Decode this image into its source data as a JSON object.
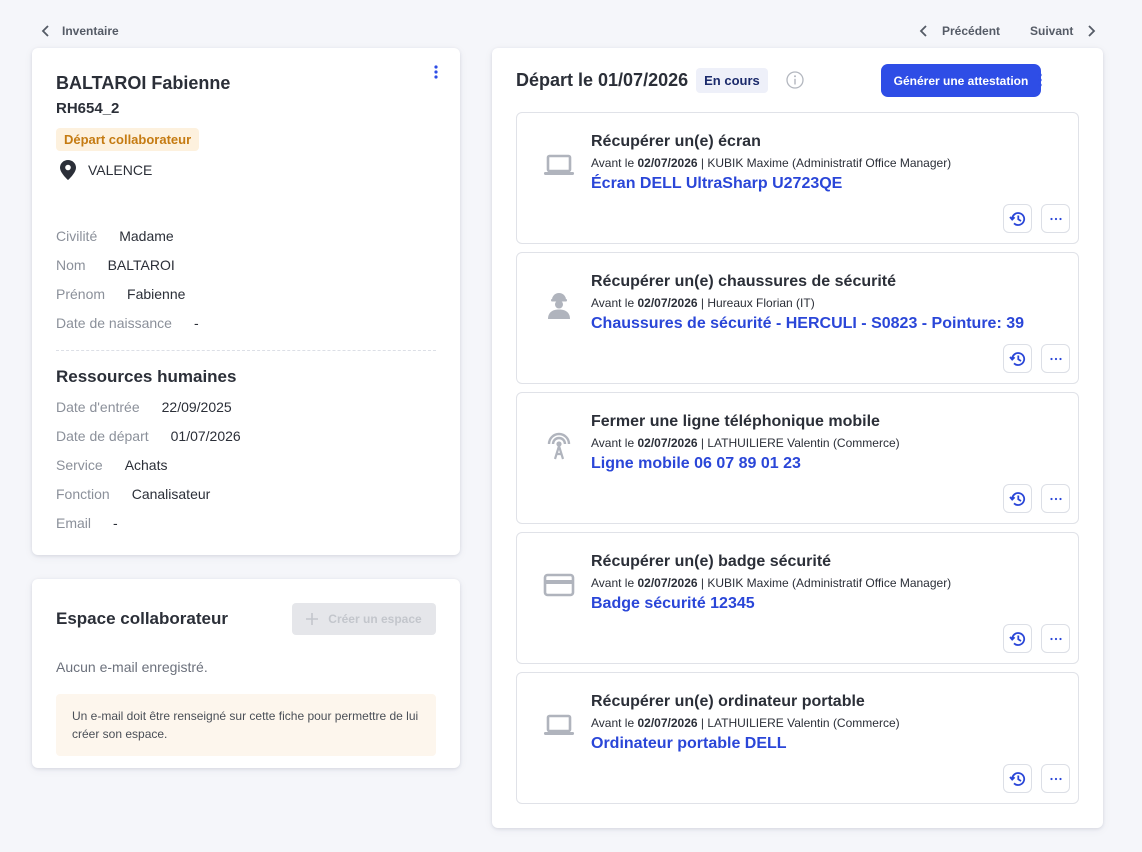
{
  "nav": {
    "back_label": "Inventaire",
    "prev_label": "Précédent",
    "next_label": "Suivant"
  },
  "profile": {
    "name": "BALTAROI Fabienne",
    "id": "RH654_2",
    "tag": "Départ collaborateur",
    "location": "VALENCE",
    "fields": [
      {
        "label": "Civilité",
        "value": "Madame"
      },
      {
        "label": "Nom",
        "value": "BALTAROI"
      },
      {
        "label": "Prénom",
        "value": "Fabienne"
      },
      {
        "label": "Date de naissance",
        "value": "-"
      }
    ],
    "hr_title": "Ressources humaines",
    "hr_fields": [
      {
        "label": "Date d'entrée",
        "value": "22/09/2025"
      },
      {
        "label": "Date de départ",
        "value": "01/07/2026"
      },
      {
        "label": "Service",
        "value": "Achats"
      },
      {
        "label": "Fonction",
        "value": "Canalisateur"
      },
      {
        "label": "Email",
        "value": "-"
      }
    ]
  },
  "espace": {
    "title": "Espace collaborateur",
    "create_label": "Créer un espace",
    "no_email": "Aucun e-mail enregistré.",
    "warning": "Un e-mail doit être renseigné sur cette fiche pour permettre de lui créer son espace."
  },
  "departure": {
    "title": "Départ le 01/07/2026",
    "status": "En cours",
    "generate_label": "Générer une attestation",
    "colors": {
      "accent": "#2e4de6",
      "link": "#2a46d8",
      "status_bg": "#eef0f9"
    },
    "tasks": [
      {
        "icon": "laptop-icon",
        "title": "Récupérer un(e) écran",
        "prefix": "Avant le ",
        "date": "02/07/2026",
        "assignee": " | KUBIK Maxime (Administratif Office Manager)",
        "item": "Écran DELL UltraSharp U2723QE"
      },
      {
        "icon": "worker-icon",
        "title": "Récupérer un(e) chaussures de sécurité",
        "prefix": "Avant le ",
        "date": "02/07/2026",
        "assignee": " | Hureaux Florian (IT)",
        "item": "Chaussures de sécurité - HERCULI - S0823 - Pointure: 39"
      },
      {
        "icon": "antenna-icon",
        "title": "Fermer une ligne téléphonique mobile",
        "prefix": "Avant le ",
        "date": "02/07/2026",
        "assignee": " | LATHUILIERE Valentin (Commerce)",
        "item": "Ligne mobile 06 07 89 01 23"
      },
      {
        "icon": "card-icon",
        "title": "Récupérer un(e) badge sécurité",
        "prefix": "Avant le ",
        "date": "02/07/2026",
        "assignee": " | KUBIK Maxime (Administratif Office Manager)",
        "item": "Badge sécurité 12345"
      },
      {
        "icon": "laptop-icon",
        "title": "Récupérer un(e) ordinateur portable",
        "prefix": "Avant le ",
        "date": "02/07/2026",
        "assignee": " | LATHUILIERE Valentin (Commerce)",
        "item": "Ordinateur portable DELL"
      }
    ]
  }
}
